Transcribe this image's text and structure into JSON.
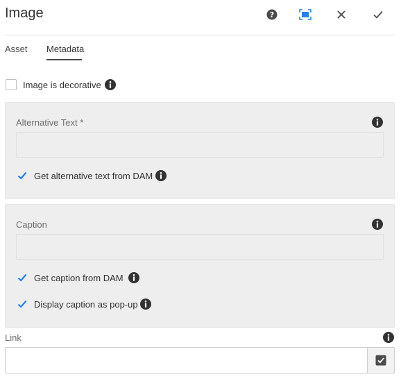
{
  "dialog": {
    "title": "Image",
    "actions": [
      {
        "icon": "help-icon"
      },
      {
        "icon": "fullscreen-icon"
      },
      {
        "icon": "close-icon"
      },
      {
        "icon": "checkmark-icon"
      }
    ]
  },
  "tabs": [
    {
      "label": "Asset",
      "active": false
    },
    {
      "label": "Metadata",
      "active": true
    }
  ],
  "decorative": {
    "label": "Image is decorative",
    "checked": false
  },
  "alt_panel": {
    "label": "Alternative Text *",
    "value": "",
    "from_dam": {
      "label": "Get alternative text from DAM",
      "checked": true
    }
  },
  "caption_panel": {
    "label": "Caption",
    "value": "",
    "from_dam": {
      "label": "Get caption from DAM",
      "checked": true
    },
    "popup": {
      "label": "Display caption as pop-up",
      "checked": true
    }
  },
  "link": {
    "label": "Link",
    "value": ""
  },
  "colors": {
    "accent": "#2680eb",
    "icon": "#4b4b4b",
    "panel_bg": "#eeeeee"
  }
}
